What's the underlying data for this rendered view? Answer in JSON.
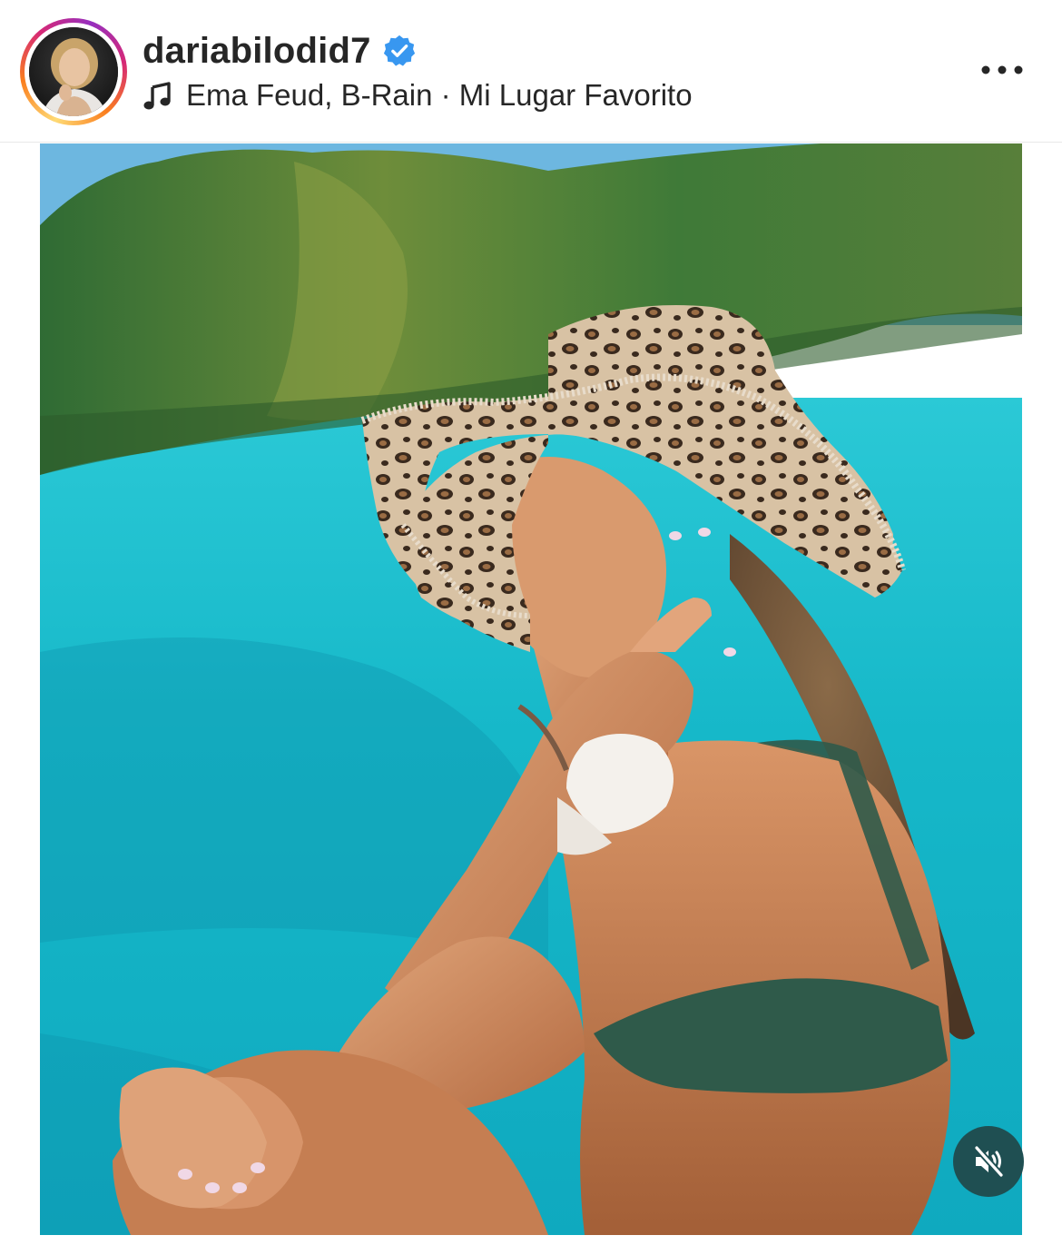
{
  "post": {
    "username": "dariabilodid7",
    "verified": true,
    "music": {
      "artists": "Ema Feud, B-Rain",
      "separator": " · ",
      "title": "Mi Lugar Favorito"
    }
  },
  "media": {
    "audio_state": "muted"
  },
  "icons": {
    "verified": "verified-badge-icon",
    "music": "music-note-icon",
    "more": "more-options-icon",
    "mute": "speaker-muted-icon"
  },
  "colors": {
    "verified_blue": "#3897f0",
    "mute_button": "#1f4f52",
    "text": "#262626"
  }
}
